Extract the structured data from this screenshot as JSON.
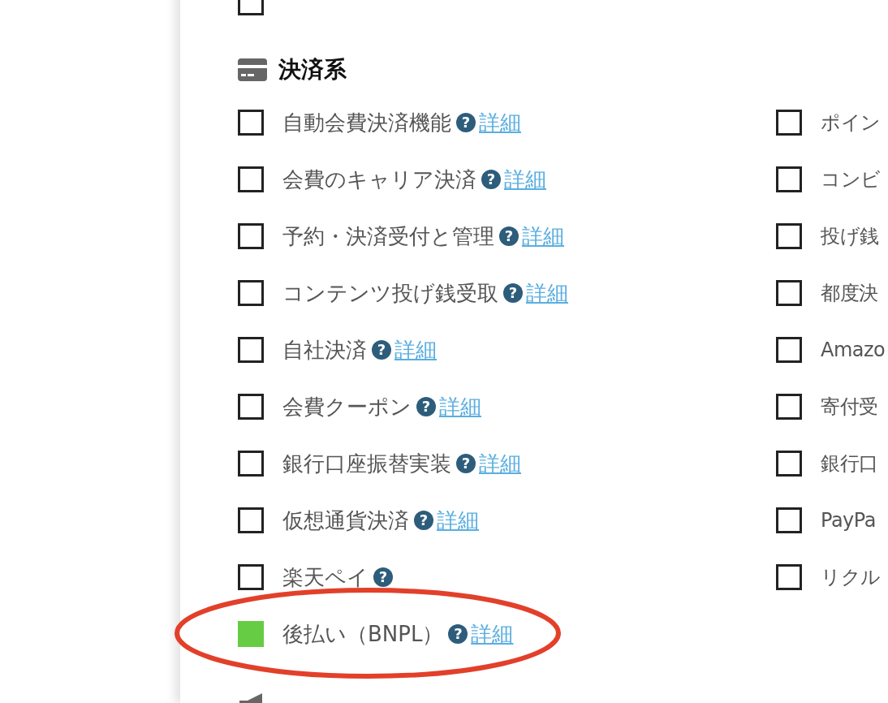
{
  "previous_item": {
    "checked": false
  },
  "section": {
    "title": "決済系",
    "left_items": [
      {
        "label": "自動会費決済機能",
        "checked": false,
        "help": "?",
        "link": "詳細",
        "circled": false
      },
      {
        "label": "会費のキャリア決済",
        "checked": false,
        "help": "?",
        "link": "詳細",
        "circled": false
      },
      {
        "label": "予約・決済受付と管理",
        "checked": false,
        "help": "?",
        "link": "詳細",
        "circled": false
      },
      {
        "label": "コンテンツ投げ銭受取",
        "checked": false,
        "help": "?",
        "link": "詳細",
        "circled": false
      },
      {
        "label": "自社決済",
        "checked": false,
        "help": "?",
        "link": "詳細",
        "circled": false
      },
      {
        "label": "会費クーポン",
        "checked": false,
        "help": "?",
        "link": "詳細",
        "circled": false
      },
      {
        "label": "銀行口座振替実装",
        "checked": false,
        "help": "?",
        "link": "詳細",
        "circled": false
      },
      {
        "label": "仮想通貨決済",
        "checked": false,
        "help": "?",
        "link": "詳細",
        "circled": false
      },
      {
        "label": "楽天ペイ",
        "checked": false,
        "help": "?",
        "circled": false
      },
      {
        "label": "後払い（BNPL）",
        "checked": true,
        "help": "?",
        "link": "詳細",
        "circled": true
      }
    ],
    "right_items": [
      {
        "label": "ポイン",
        "checked": false
      },
      {
        "label": "コンビ",
        "checked": false
      },
      {
        "label": "投げ銭",
        "checked": false
      },
      {
        "label": "都度決",
        "checked": false
      },
      {
        "label": "Amazo",
        "checked": false
      },
      {
        "label": "寄付受",
        "checked": false
      },
      {
        "label": "銀行口",
        "checked": false
      },
      {
        "label": "PayPa",
        "checked": false
      },
      {
        "label": "リクル",
        "checked": false
      }
    ]
  },
  "next_section": {
    "kind": "megaphone"
  }
}
